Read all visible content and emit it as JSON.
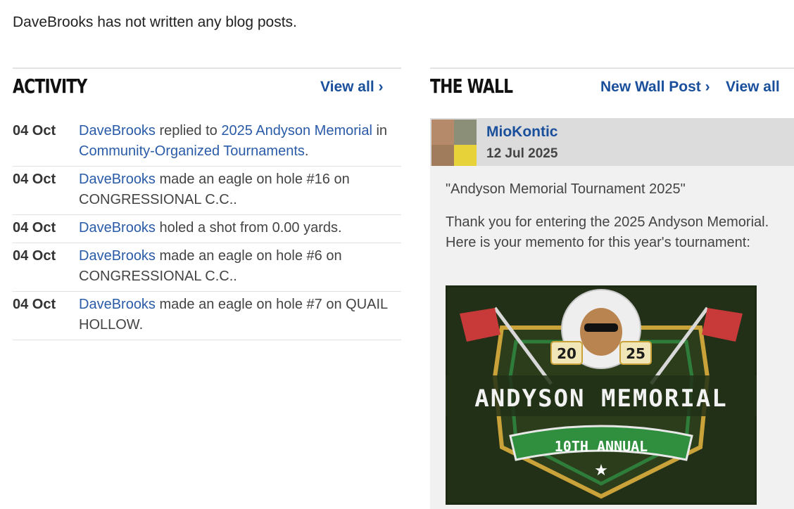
{
  "intro": "DaveBrooks has not written any blog posts.",
  "activity": {
    "title": "ACTIVITY",
    "view_all": "View all ›",
    "items": [
      {
        "date": "04 Oct",
        "user": "DaveBrooks",
        "pre": " replied to ",
        "link1": "2025 Andyson Memorial",
        "mid": " in ",
        "link2": "Community-Organized Tournaments",
        "post": "."
      },
      {
        "date": "04 Oct",
        "user": "DaveBrooks",
        "pre": " made an eagle on hole #16 on CONGRESSIONAL C.C..",
        "link1": "",
        "mid": "",
        "link2": "",
        "post": ""
      },
      {
        "date": "04 Oct",
        "user": "DaveBrooks",
        "pre": " holed a shot from 0.00 yards.",
        "link1": "",
        "mid": "",
        "link2": "",
        "post": ""
      },
      {
        "date": "04 Oct",
        "user": "DaveBrooks",
        "pre": " made an eagle on hole #6 on CONGRESSIONAL C.C..",
        "link1": "",
        "mid": "",
        "link2": "",
        "post": ""
      },
      {
        "date": "04 Oct",
        "user": "DaveBrooks",
        "pre": " made an eagle on hole #7 on QUAIL HOLLOW.",
        "link1": "",
        "mid": "",
        "link2": "",
        "post": ""
      }
    ]
  },
  "wall": {
    "title": "THE WALL",
    "new_post": "New Wall Post ›",
    "view_all": "View all",
    "post": {
      "author": "MioKontic",
      "date": "12 Jul 2025",
      "title": "\"Andyson Memorial Tournament 2025\"",
      "body": "Thank you for entering the 2025 Andyson Memorial.  Here is your memento for this year's tournament:",
      "image": {
        "year_left": "20",
        "year_right": "25",
        "name": "ANDYSON MEMORIAL",
        "annual": "10TH ANNUAL",
        "star": "★"
      }
    }
  }
}
